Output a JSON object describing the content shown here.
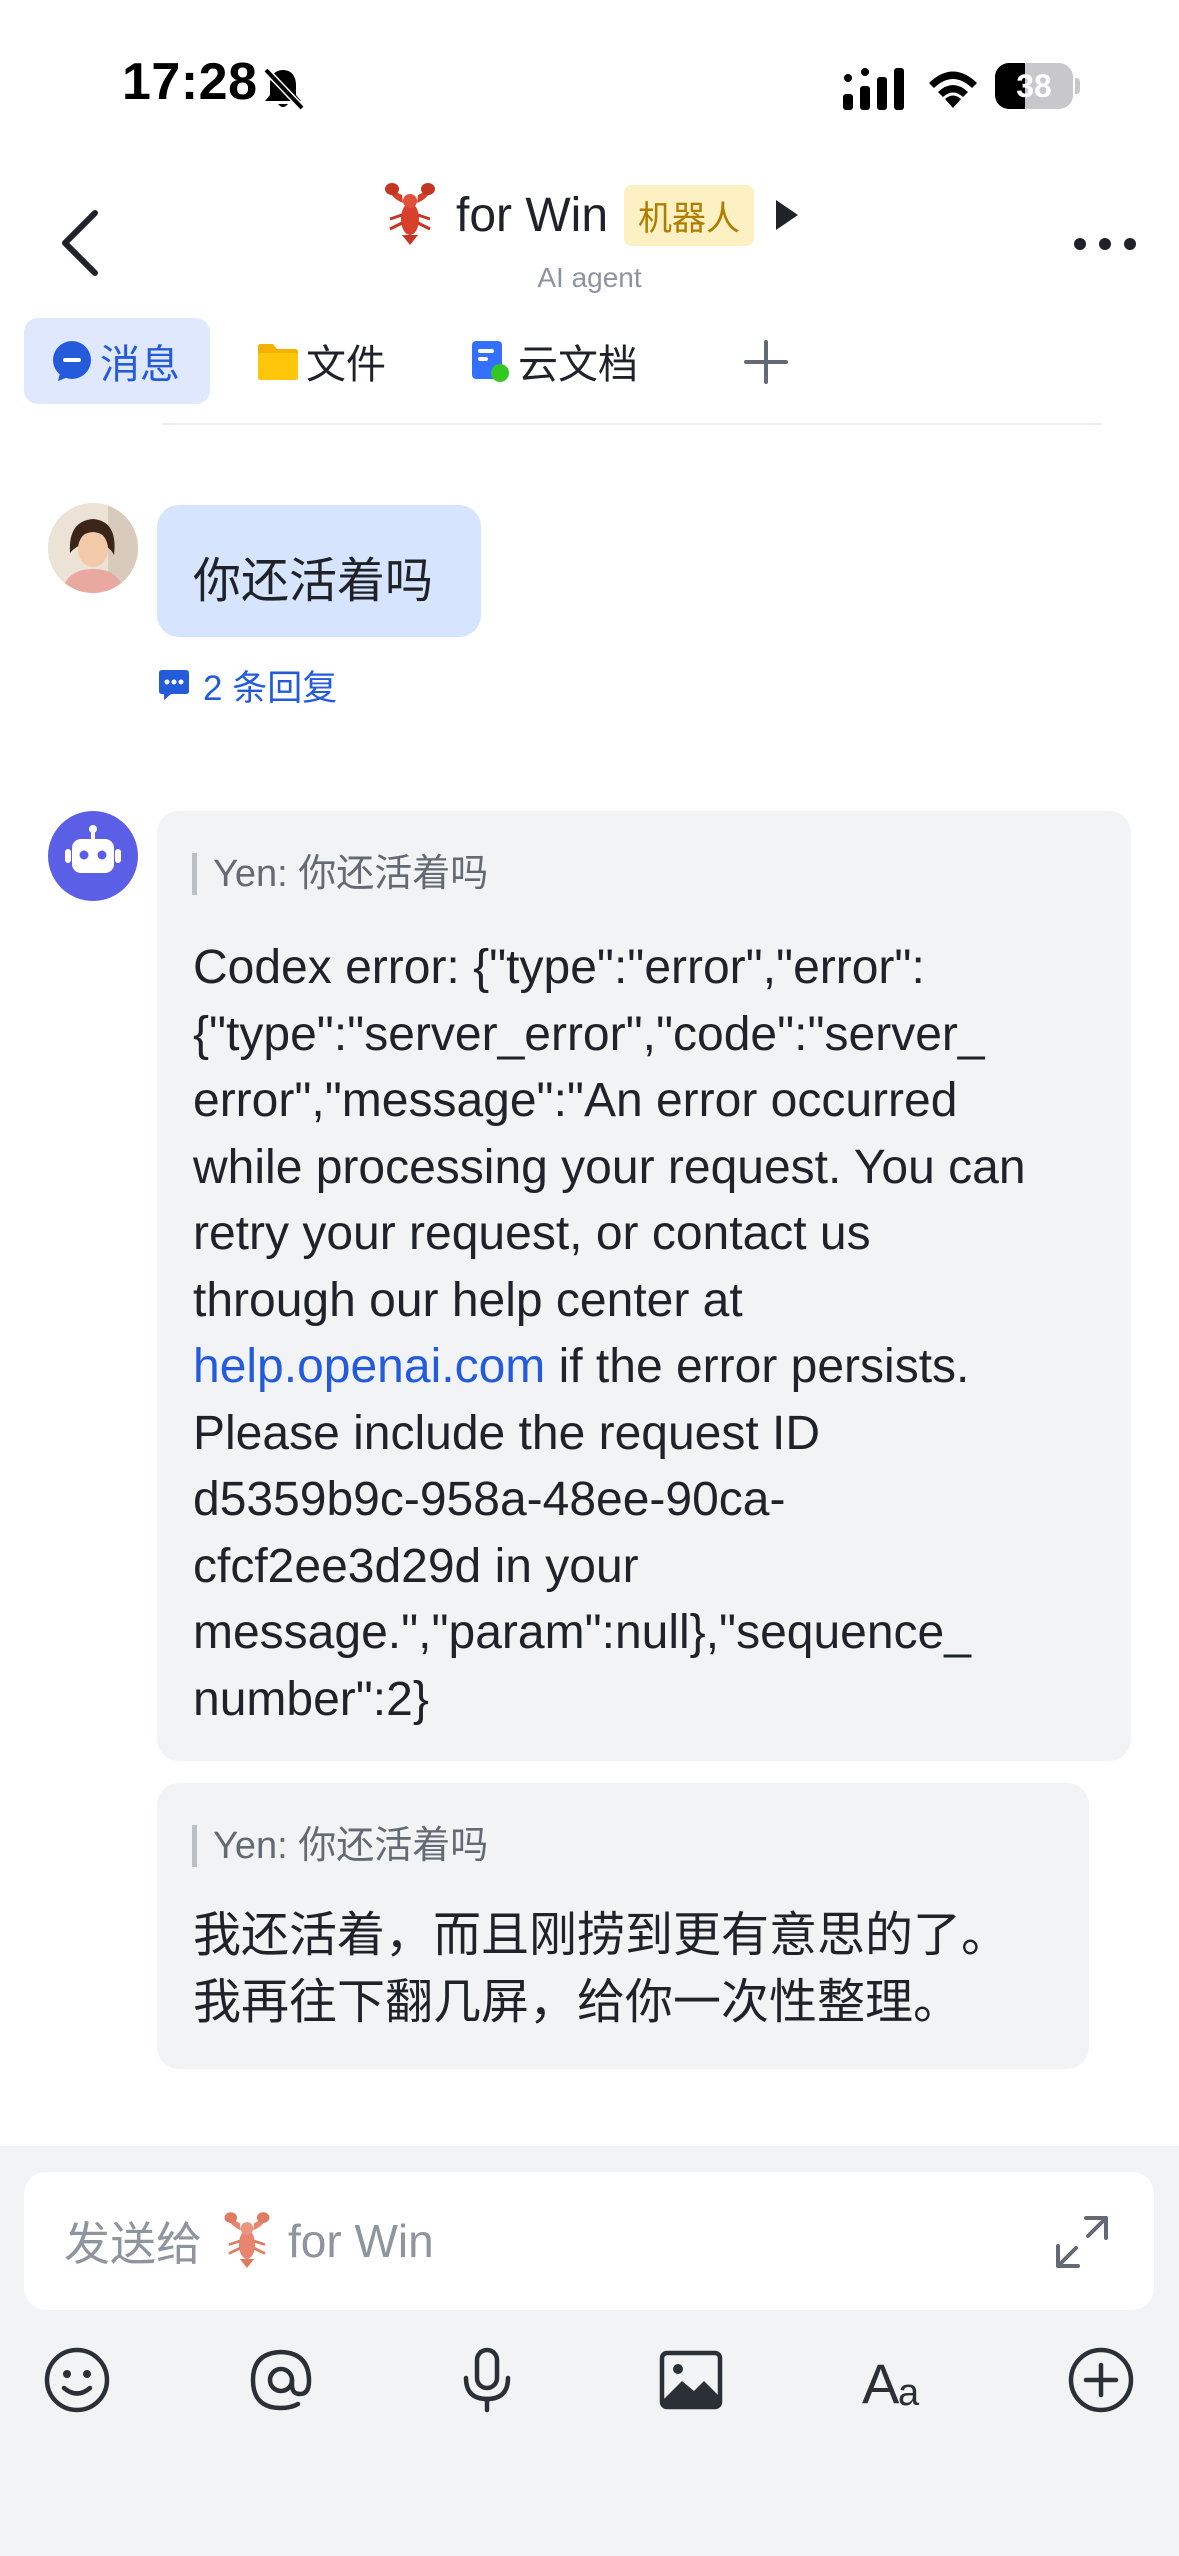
{
  "status_bar": {
    "time": "17:28",
    "battery": "38"
  },
  "header": {
    "title": "for Win",
    "badge": "机器人",
    "subtitle": "AI agent"
  },
  "tabs": [
    {
      "label": "消息",
      "icon": "message-icon",
      "active": true
    },
    {
      "label": "文件",
      "icon": "folder-icon",
      "active": false
    },
    {
      "label": "云文档",
      "icon": "doc-icon",
      "active": false
    }
  ],
  "messages": {
    "user_message": "你还活着吗",
    "reply_count_label": "2 条回复",
    "bot_message_1": {
      "quote": "Yen: 你还活着吗",
      "lines": [
        "Codex error: {\"type\":\"error\",\"error\":",
        "{\"type\":\"server_error\",\"code\":\"server_",
        "error\",\"message\":\"An error occurred",
        "while processing your request. You can",
        "retry your request, or contact us",
        "through our help center at"
      ],
      "link_text": "help.openai.com",
      "link_tail": " if the error persists.",
      "lines_after": [
        "Please include the request ID",
        "d5359b9c-958a-48ee-90ca-",
        "cfcf2ee3d29d in your",
        "message.\",\"param\":null},\"sequence_",
        "number\":2}"
      ]
    },
    "bot_message_2": {
      "quote": "Yen: 你还活着吗",
      "lines": [
        "我还活着，而且刚捞到更有意思的了。",
        "我再往下翻几屏，给你一次性整理。"
      ]
    }
  },
  "composer": {
    "placeholder_prefix": "发送给",
    "placeholder_name": "for Win"
  },
  "toolbar_icons": [
    "emoji-icon",
    "mention-icon",
    "microphone-icon",
    "image-icon",
    "text-format-icon",
    "add-icon"
  ],
  "colors": {
    "accent": "#245bdb",
    "user_bubble": "#d7e4fd",
    "bot_bubble": "#f2f3f5",
    "bot_avatar": "#5b5fe6",
    "badge_bg": "#fdf0c2",
    "badge_text": "#b07d00"
  }
}
